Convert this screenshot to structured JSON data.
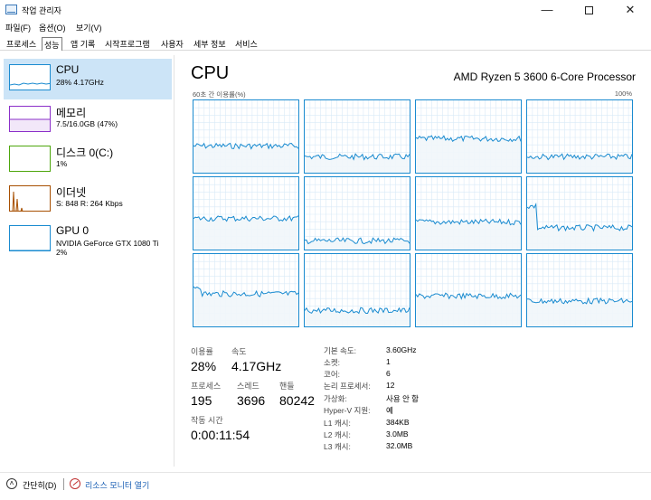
{
  "window": {
    "title": "작업 관리자",
    "minimize_glyph": "—",
    "close_glyph": "✕"
  },
  "menu": [
    "파일(F)",
    "옵션(O)",
    "보기(V)"
  ],
  "tabs": [
    "프로세스",
    "성능",
    "앱 기록",
    "시작프로그램",
    "사용자",
    "세부 정보",
    "서비스"
  ],
  "active_tab": "성능",
  "sidebar": {
    "items": [
      {
        "title": "CPU",
        "lines": [
          "28% 4.17GHz"
        ],
        "color": "#1a8bd0"
      },
      {
        "title": "메모리",
        "lines": [
          "7.5/16.0GB (47%)"
        ],
        "color": "#8b2fc9"
      },
      {
        "title": "디스크 0(C:)",
        "lines": [
          "1%"
        ],
        "color": "#4da60c"
      },
      {
        "title": "이더넷",
        "lines": [
          "S: 848  R: 264 Kbps"
        ],
        "color": "#a74f01"
      },
      {
        "title": "GPU 0",
        "lines": [
          "NVIDIA GeForce GTX 1080 Ti",
          "2%"
        ],
        "color": "#1a8bd0"
      }
    ]
  },
  "main": {
    "heading": "CPU",
    "processor": "AMD Ryzen 5 3600 6-Core Processor",
    "graph_label": "60초 간 이용률(%)",
    "graph_max": "100%",
    "core_count": 12
  },
  "stats": {
    "utilization": {
      "label": "이용률",
      "value": "28%"
    },
    "speed": {
      "label": "속도",
      "value": "4.17GHz"
    },
    "processes": {
      "label": "프로세스",
      "value": "195"
    },
    "threads": {
      "label": "스레드",
      "value": "3696"
    },
    "handles": {
      "label": "핸들",
      "value": "80242"
    },
    "uptime": {
      "label": "작동 시간",
      "value": "0:00:11:54"
    }
  },
  "info": [
    {
      "label": "기본 속도:",
      "value": "3.60GHz"
    },
    {
      "label": "소켓:",
      "value": "1"
    },
    {
      "label": "코어:",
      "value": "6"
    },
    {
      "label": "논리 프로세서:",
      "value": "12"
    },
    {
      "label": "가상화:",
      "value": "사용 안 함"
    },
    {
      "label": "Hyper-V 지원:",
      "value": "예"
    },
    {
      "label": "L1 캐시:",
      "value": "384KB"
    },
    {
      "label": "L2 캐시:",
      "value": "3.0MB"
    },
    {
      "label": "L3 캐시:",
      "value": "32.0MB"
    }
  ],
  "footer": {
    "fewer_details": "간단히(D)",
    "resource_monitor": "리소스 모니터 열기"
  },
  "colors": {
    "cpu_line": "#1a8bd0",
    "cpu_fill": "#f1f6fa",
    "grid": "#d9eaf7",
    "selected": "#cce4f7"
  }
}
